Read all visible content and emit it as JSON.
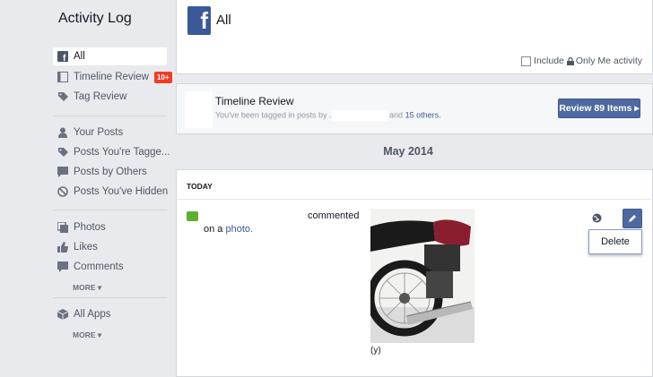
{
  "sidebar": {
    "title": "Activity Log",
    "items": [
      {
        "label": "All",
        "icon": "facebook-icon"
      },
      {
        "label": "Timeline Review",
        "icon": "timeline-icon",
        "badge": "10+"
      },
      {
        "label": "Tag Review",
        "icon": "tag-icon"
      },
      {
        "label": "Your Posts",
        "icon": "person-icon"
      },
      {
        "label": "Posts You're Tagge...",
        "icon": "tag-icon"
      },
      {
        "label": "Posts by Others",
        "icon": "speech-icon"
      },
      {
        "label": "Posts You've Hidden",
        "icon": "hidden-icon"
      },
      {
        "label": "Photos",
        "icon": "photos-icon"
      },
      {
        "label": "Likes",
        "icon": "like-icon"
      },
      {
        "label": "Comments",
        "icon": "comment-icon"
      },
      {
        "label": "All Apps",
        "icon": "apps-icon"
      }
    ],
    "more_label": "MORE"
  },
  "header": {
    "title": "All"
  },
  "filter": {
    "include_label": "Include",
    "only_me_label": "Only Me activity"
  },
  "timeline_review": {
    "title": "Timeline Review",
    "subtitle_prefix": "You've been tagged in posts by .",
    "subtitle_and": "and",
    "others_link": "15 others.",
    "button_label": "Review 89 Items"
  },
  "month": "May 2014",
  "day_label": "TODAY",
  "activity": {
    "verb": "commented",
    "on_a": "on a",
    "photo_link": "photo.",
    "caption": "(y)",
    "menu_item": "Delete"
  },
  "colors": {
    "brand": "#3b5998",
    "button": "#4e69a2",
    "badge": "#f03d25"
  }
}
